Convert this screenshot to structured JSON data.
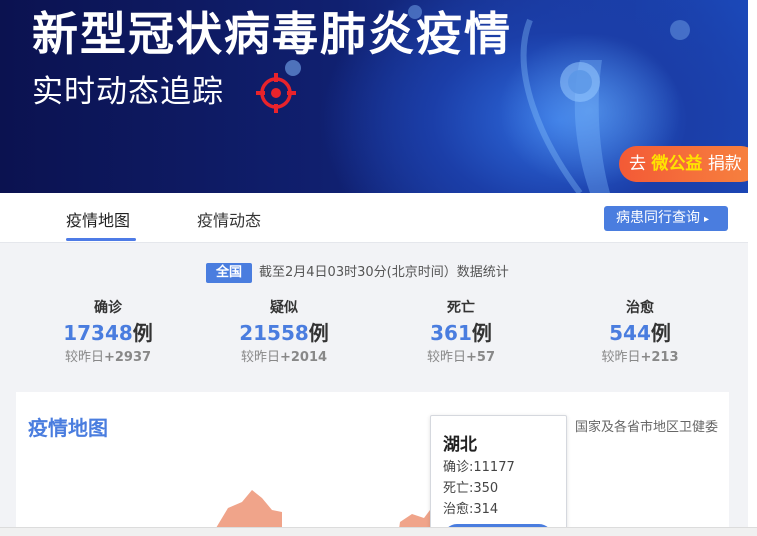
{
  "banner": {
    "title": "新型冠状病毒肺炎疫情",
    "subtitle": "实时动态追踪",
    "donate": {
      "prefix": "去",
      "highlight": "微公益",
      "suffix": "捐款"
    }
  },
  "tabs": [
    {
      "label": "疫情地图",
      "active": true
    },
    {
      "label": "疫情动态",
      "active": false
    }
  ],
  "query_button": {
    "label": "病患同行查询",
    "arrow": "▸"
  },
  "summary": {
    "scope": "全国",
    "as_of": "截至2月4日03时30分(北京时间）数据统计",
    "stats": [
      {
        "label": "确诊",
        "value": "17348",
        "unit": "例",
        "delta_label": "较昨日",
        "delta": "+2937"
      },
      {
        "label": "疑似",
        "value": "21558",
        "unit": "例",
        "delta_label": "较昨日",
        "delta": "+2014"
      },
      {
        "label": "死亡",
        "value": "361",
        "unit": "例",
        "delta_label": "较昨日",
        "delta": "+57"
      },
      {
        "label": "治愈",
        "value": "544",
        "unit": "例",
        "delta_label": "较昨日",
        "delta": "+213"
      }
    ]
  },
  "map": {
    "title": "疫情地图",
    "source": "数据来源：国家及各省市地区卫健委",
    "tooltip": {
      "region": "湖北",
      "confirmed": "确诊:11177",
      "deaths": "死亡:350",
      "cured": "治愈:314"
    }
  },
  "colors": {
    "accent": "#4a7ddf",
    "donate": "#f35a36",
    "map_fill": "#f0a48a"
  }
}
